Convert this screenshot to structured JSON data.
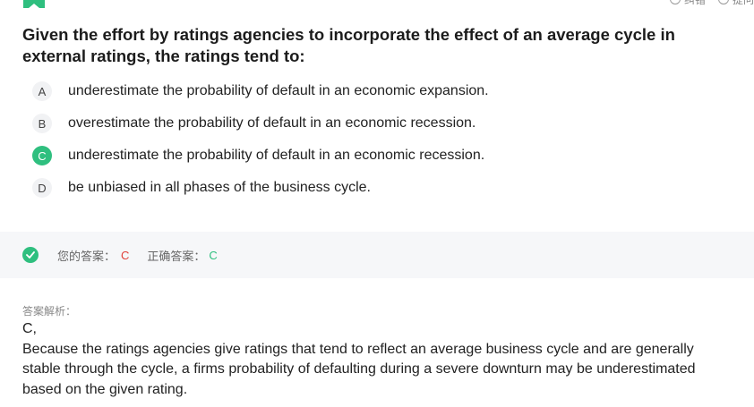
{
  "header": {
    "bookmark_icon": "bookmark-icon",
    "actions": [
      "纠错",
      "提问"
    ]
  },
  "question": {
    "text": "Given the effort by ratings agencies to incorporate the effect of an average cycle in external ratings, the ratings tend to:"
  },
  "options": [
    {
      "letter": "A",
      "text": "underestimate the probability of default in an economic expansion."
    },
    {
      "letter": "B",
      "text": "overestimate the probability of default in an economic recession."
    },
    {
      "letter": "C",
      "text": "underestimate the probability of default in an economic recession."
    },
    {
      "letter": "D",
      "text": "be unbiased in all phases of the business cycle."
    }
  ],
  "answer": {
    "your_label": "您的答案：",
    "your_value": "C",
    "correct_label": "正确答案：",
    "correct_value": "C",
    "accent": "#2fbf7f",
    "wrong_color": "#e0403a"
  },
  "analysis": {
    "label": "答案解析：",
    "answer_line": "C,",
    "text": "Because the ratings agencies give ratings that tend to reflect an average business cycle and are generally stable through the cycle, a firms probability of defaulting during a severe downturn may be underestimated based on the given rating."
  }
}
